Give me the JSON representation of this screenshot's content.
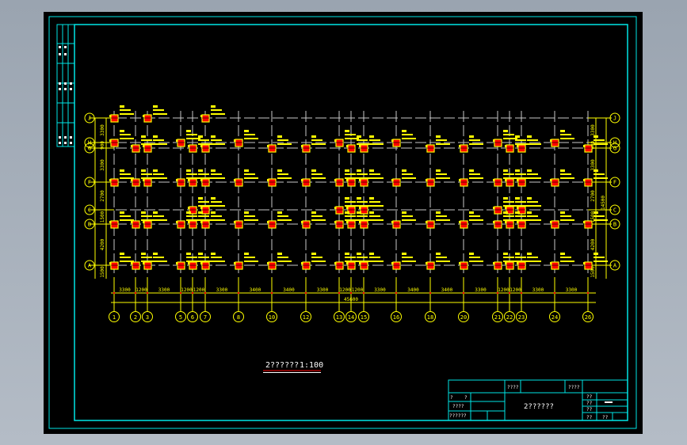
{
  "drawing": {
    "caption": "2??????",
    "scale": "1:100",
    "row_labels": [
      "J",
      "H",
      "G",
      "F",
      "C",
      "B",
      "A"
    ],
    "column_labels": [
      "1",
      "2",
      "3",
      "5",
      "6",
      "7",
      "8",
      "10",
      "12",
      "13",
      "14",
      "15",
      "16",
      "18",
      "20",
      "21",
      "22",
      "23",
      "24",
      "26"
    ],
    "bottom_dimensions": [
      "3300",
      "1200",
      "3300",
      "1200",
      "1200",
      "3300",
      "3400",
      "3400",
      "3300",
      "1200",
      "1200",
      "3300",
      "3400",
      "3400",
      "3300",
      "1200",
      "1200",
      "3300",
      "3300"
    ],
    "overall_dimension": "45600",
    "left_dimensions": [
      "3300",
      "900",
      "3300",
      "2700",
      "1500",
      "4200",
      "1500"
    ],
    "right_overall_dimension": "14500"
  },
  "title_block": {
    "top_left": "????",
    "top_right": "????",
    "left_r1a": "?",
    "left_r1b": "?",
    "left_r2": "????",
    "left_r3": "??????",
    "center": "2??????",
    "right_r1": "??",
    "right_r2": "??",
    "right_r3": "??",
    "right_r4": "??",
    "right_r4b": "??"
  },
  "colors": {
    "background": "#000000",
    "frame": "#00e5e5",
    "grid": "#c8c8c8",
    "axis": "#ffff00",
    "column": "#ff0000"
  }
}
